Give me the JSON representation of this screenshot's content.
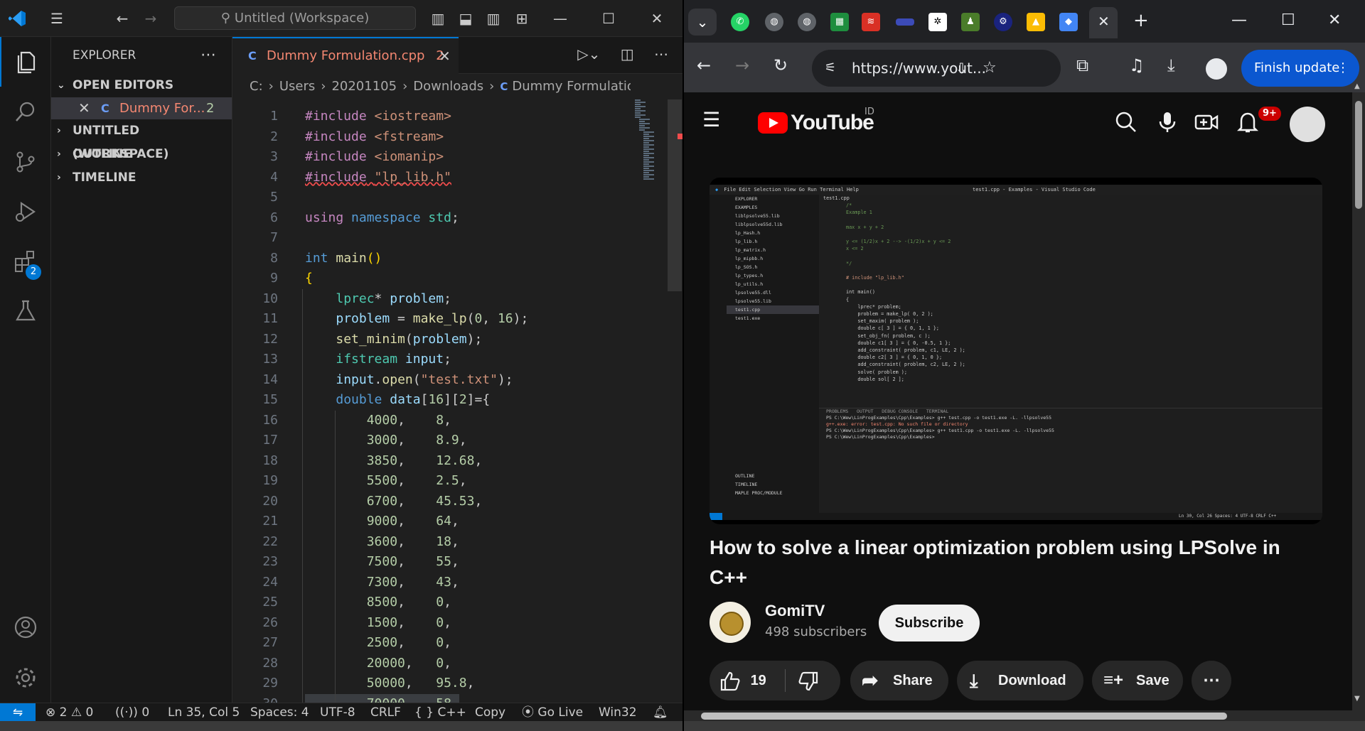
{
  "vscode": {
    "command_center": "Untitled (Workspace)",
    "sidebar": {
      "title": "EXPLORER",
      "sections": {
        "open_editors": "OPEN EDITORS",
        "workspace": "UNTITLED (WORKSPACE)",
        "outline": "OUTLINE",
        "timeline": "TIMELINE"
      },
      "open_file": {
        "name": "Dummy For...",
        "problems": "2",
        "icon": "C"
      }
    },
    "extensions_badge": "2",
    "tab": {
      "name": "Dummy Formulation.cpp",
      "problems": "2",
      "icon": "C"
    },
    "breadcrumb": [
      "C:",
      "Users",
      "20201105",
      "Downloads",
      "Dummy Formulation.cpp"
    ],
    "code_lines": [
      {
        "n": "1"
      },
      {
        "n": "2"
      },
      {
        "n": "3"
      },
      {
        "n": "4"
      },
      {
        "n": "5"
      },
      {
        "n": "6"
      },
      {
        "n": "7"
      },
      {
        "n": "8"
      },
      {
        "n": "9"
      },
      {
        "n": "10"
      },
      {
        "n": "11"
      },
      {
        "n": "12"
      },
      {
        "n": "13"
      },
      {
        "n": "14"
      },
      {
        "n": "15"
      },
      {
        "n": "16"
      },
      {
        "n": "17"
      },
      {
        "n": "18"
      },
      {
        "n": "19"
      },
      {
        "n": "20"
      },
      {
        "n": "21"
      },
      {
        "n": "22"
      },
      {
        "n": "23"
      },
      {
        "n": "24"
      },
      {
        "n": "25"
      },
      {
        "n": "26"
      },
      {
        "n": "27"
      },
      {
        "n": "28"
      },
      {
        "n": "29"
      },
      {
        "n": "30"
      }
    ],
    "data_rows": [
      [
        "4000,",
        "8,"
      ],
      [
        "3000,",
        "8.9,"
      ],
      [
        "3850,",
        "12.68,"
      ],
      [
        "5500,",
        "2.5,"
      ],
      [
        "6700,",
        "45.53,"
      ],
      [
        "9000,",
        "64,"
      ],
      [
        "3600,",
        "18,"
      ],
      [
        "7500,",
        "55,"
      ],
      [
        "7300,",
        "43,"
      ],
      [
        "8500,",
        "0,"
      ],
      [
        "1500,",
        "0,"
      ],
      [
        "2500,",
        "0,"
      ],
      [
        "20000,",
        "0,"
      ],
      [
        "50000,",
        "95.8,"
      ],
      [
        "70000,",
        "58,"
      ]
    ],
    "status": {
      "errors": "2",
      "warnings": "0",
      "ports": "0",
      "position": "Ln 35, Col 5",
      "spaces": "Spaces: 4",
      "encoding": "UTF-8",
      "eol": "CRLF",
      "language": "C++",
      "copy": "Copy",
      "golive": "Go Live",
      "platform": "Win32"
    }
  },
  "chrome": {
    "url": "https://www.yout...",
    "finish_update": "Finish update",
    "youtube": {
      "country": "ID",
      "notifications": "9+",
      "video_title": "How to solve a linear optimization problem using LPSolve in C++",
      "channel": "GomiTV",
      "subscribers": "498 subscribers",
      "subscribe": "Subscribe",
      "likes": "19",
      "share": "Share",
      "download": "Download",
      "save": "Save",
      "player_preview": {
        "window_title": "test1.cpp - Examples - Visual Studio Code",
        "menu": "File  Edit  Selection  View  Go  Run  Terminal  Help",
        "explorer": "EXPLORER",
        "folder": "EXAMPLES",
        "files": [
          "liblpsolve55.lib",
          "liblpsolve55d.lib",
          "lp_Hash.h",
          "lp_lib.h",
          "lp_matrix.h",
          "lp_mipbb.h",
          "lp_SOS.h",
          "lp_types.h",
          "lp_utils.h",
          "lpsolve55.dll",
          "lpsolve55.lib",
          "test1.cpp",
          "test1.exe"
        ],
        "bottom_sections": [
          "OUTLINE",
          "TIMELINE",
          "MAPLE PROC/MODULE"
        ],
        "tab": "test1.cpp",
        "code": [
          "/*",
          "Example 1",
          "",
          "max x + y + 2",
          "",
          "y <= (1/2)x + 2 --> -(1/2)x + y <= 2",
          "x <= 2",
          "",
          "*/",
          "",
          "# include \"lp_lib.h\"",
          "",
          "int main()",
          "{",
          "    lprec* problem;",
          "    problem = make_lp( 0, 2 );",
          "    set_maxim( problem );",
          "    double c[ 3 ] = { 0, 1, 1 };",
          "    set_obj_fn( problem, c );",
          "    double c1[ 3 ] = { 0, -0.5, 1 };",
          "    add_constraint( problem, c1, LE, 2 );",
          "    double c2[ 3 ] = { 0, 1, 0 };",
          "    add_constraint( problem, c2, LE, 2 );",
          "    solve( problem );",
          "    double sol[ 2 ];"
        ],
        "terminal_tabs": "PROBLEMS   OUTPUT   DEBUG CONSOLE   TERMINAL",
        "terminal": [
          "PS C:\\Wew\\LinProgExamples\\Cpp\\Examples> g++ test.cpp -o test1.exe -L. -llpsolve55",
          "g++.exe: error: test.cpp: No such file or directory",
          "PS C:\\Wew\\LinProgExamples\\Cpp\\Examples> g++ test1.cpp -o test1.exe -L. -llpsolve55",
          "PS C:\\Wew\\LinProgExamples\\Cpp\\Examples> "
        ],
        "status_right": "Ln 30, Col 26   Spaces: 4   UTF-8   CRLF   C++"
      }
    }
  }
}
